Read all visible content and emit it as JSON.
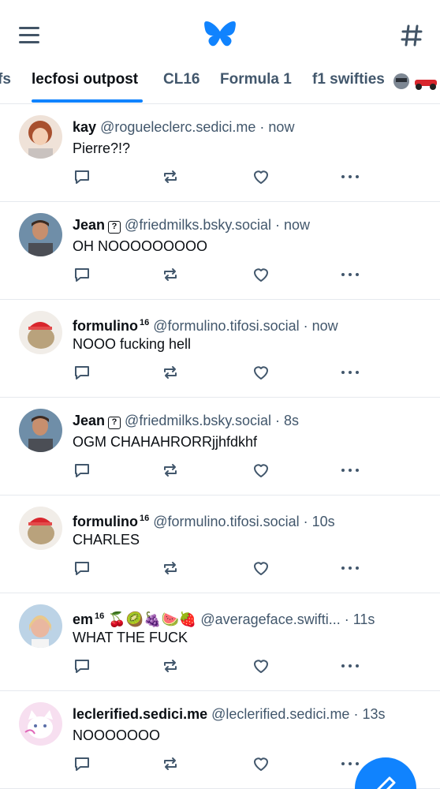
{
  "header": {
    "menu_icon": "hamburger-menu-icon",
    "logo_icon": "butterfly-logo-icon",
    "feeds_icon": "hash-icon",
    "accent_color": "#1083fe"
  },
  "tabs": [
    {
      "label": "fs",
      "active": false
    },
    {
      "label": "lecfosi outpost",
      "active": true
    },
    {
      "label": "CL16",
      "active": false
    },
    {
      "label": "Formula 1",
      "active": false
    },
    {
      "label": "f1 swifties",
      "active": false
    }
  ],
  "posts": [
    {
      "name": "kay",
      "badge": "",
      "handle": "@rogueleclerc.sedici.me",
      "sep": " · ",
      "time": "now",
      "text": "Pierre?!?"
    },
    {
      "name": "Jean",
      "badge": "?",
      "handle": "@friedmilks.bsky.social",
      "sep": " · ",
      "time": "now",
      "text": "OH NOOOOOOOOO"
    },
    {
      "name": "formulino",
      "badge": "16",
      "handle": "@formulino.tifosi.social",
      "sep": " · ",
      "time": "now",
      "text": "NOOO fucking hell"
    },
    {
      "name": "Jean",
      "badge": "?",
      "handle": "@friedmilks.bsky.social",
      "sep": " · ",
      "time": "8s",
      "text": "OGM CHAHAHRORRjjhfdkhf"
    },
    {
      "name": "formulino",
      "badge": "16",
      "handle": "@formulino.tifosi.social",
      "sep": " · ",
      "time": "10s",
      "text": "CHARLES"
    },
    {
      "name": "em",
      "badge": "16",
      "emoji": "🍒🥝🍇🍉🍓",
      "handle": "@averageface.swifti...",
      "sep": " · ",
      "time": "11s",
      "text": "WHAT THE FUCK"
    },
    {
      "name": "leclerified.sedici.me",
      "badge": "",
      "handle": "@leclerified.sedici.me",
      "sep": " · ",
      "time": "13s",
      "text": "NOOOOOOO"
    }
  ],
  "post_actions": [
    "reply-icon",
    "repost-icon",
    "like-heart-icon",
    "more-options-icon"
  ],
  "compose_icon": "compose-pencil-icon"
}
